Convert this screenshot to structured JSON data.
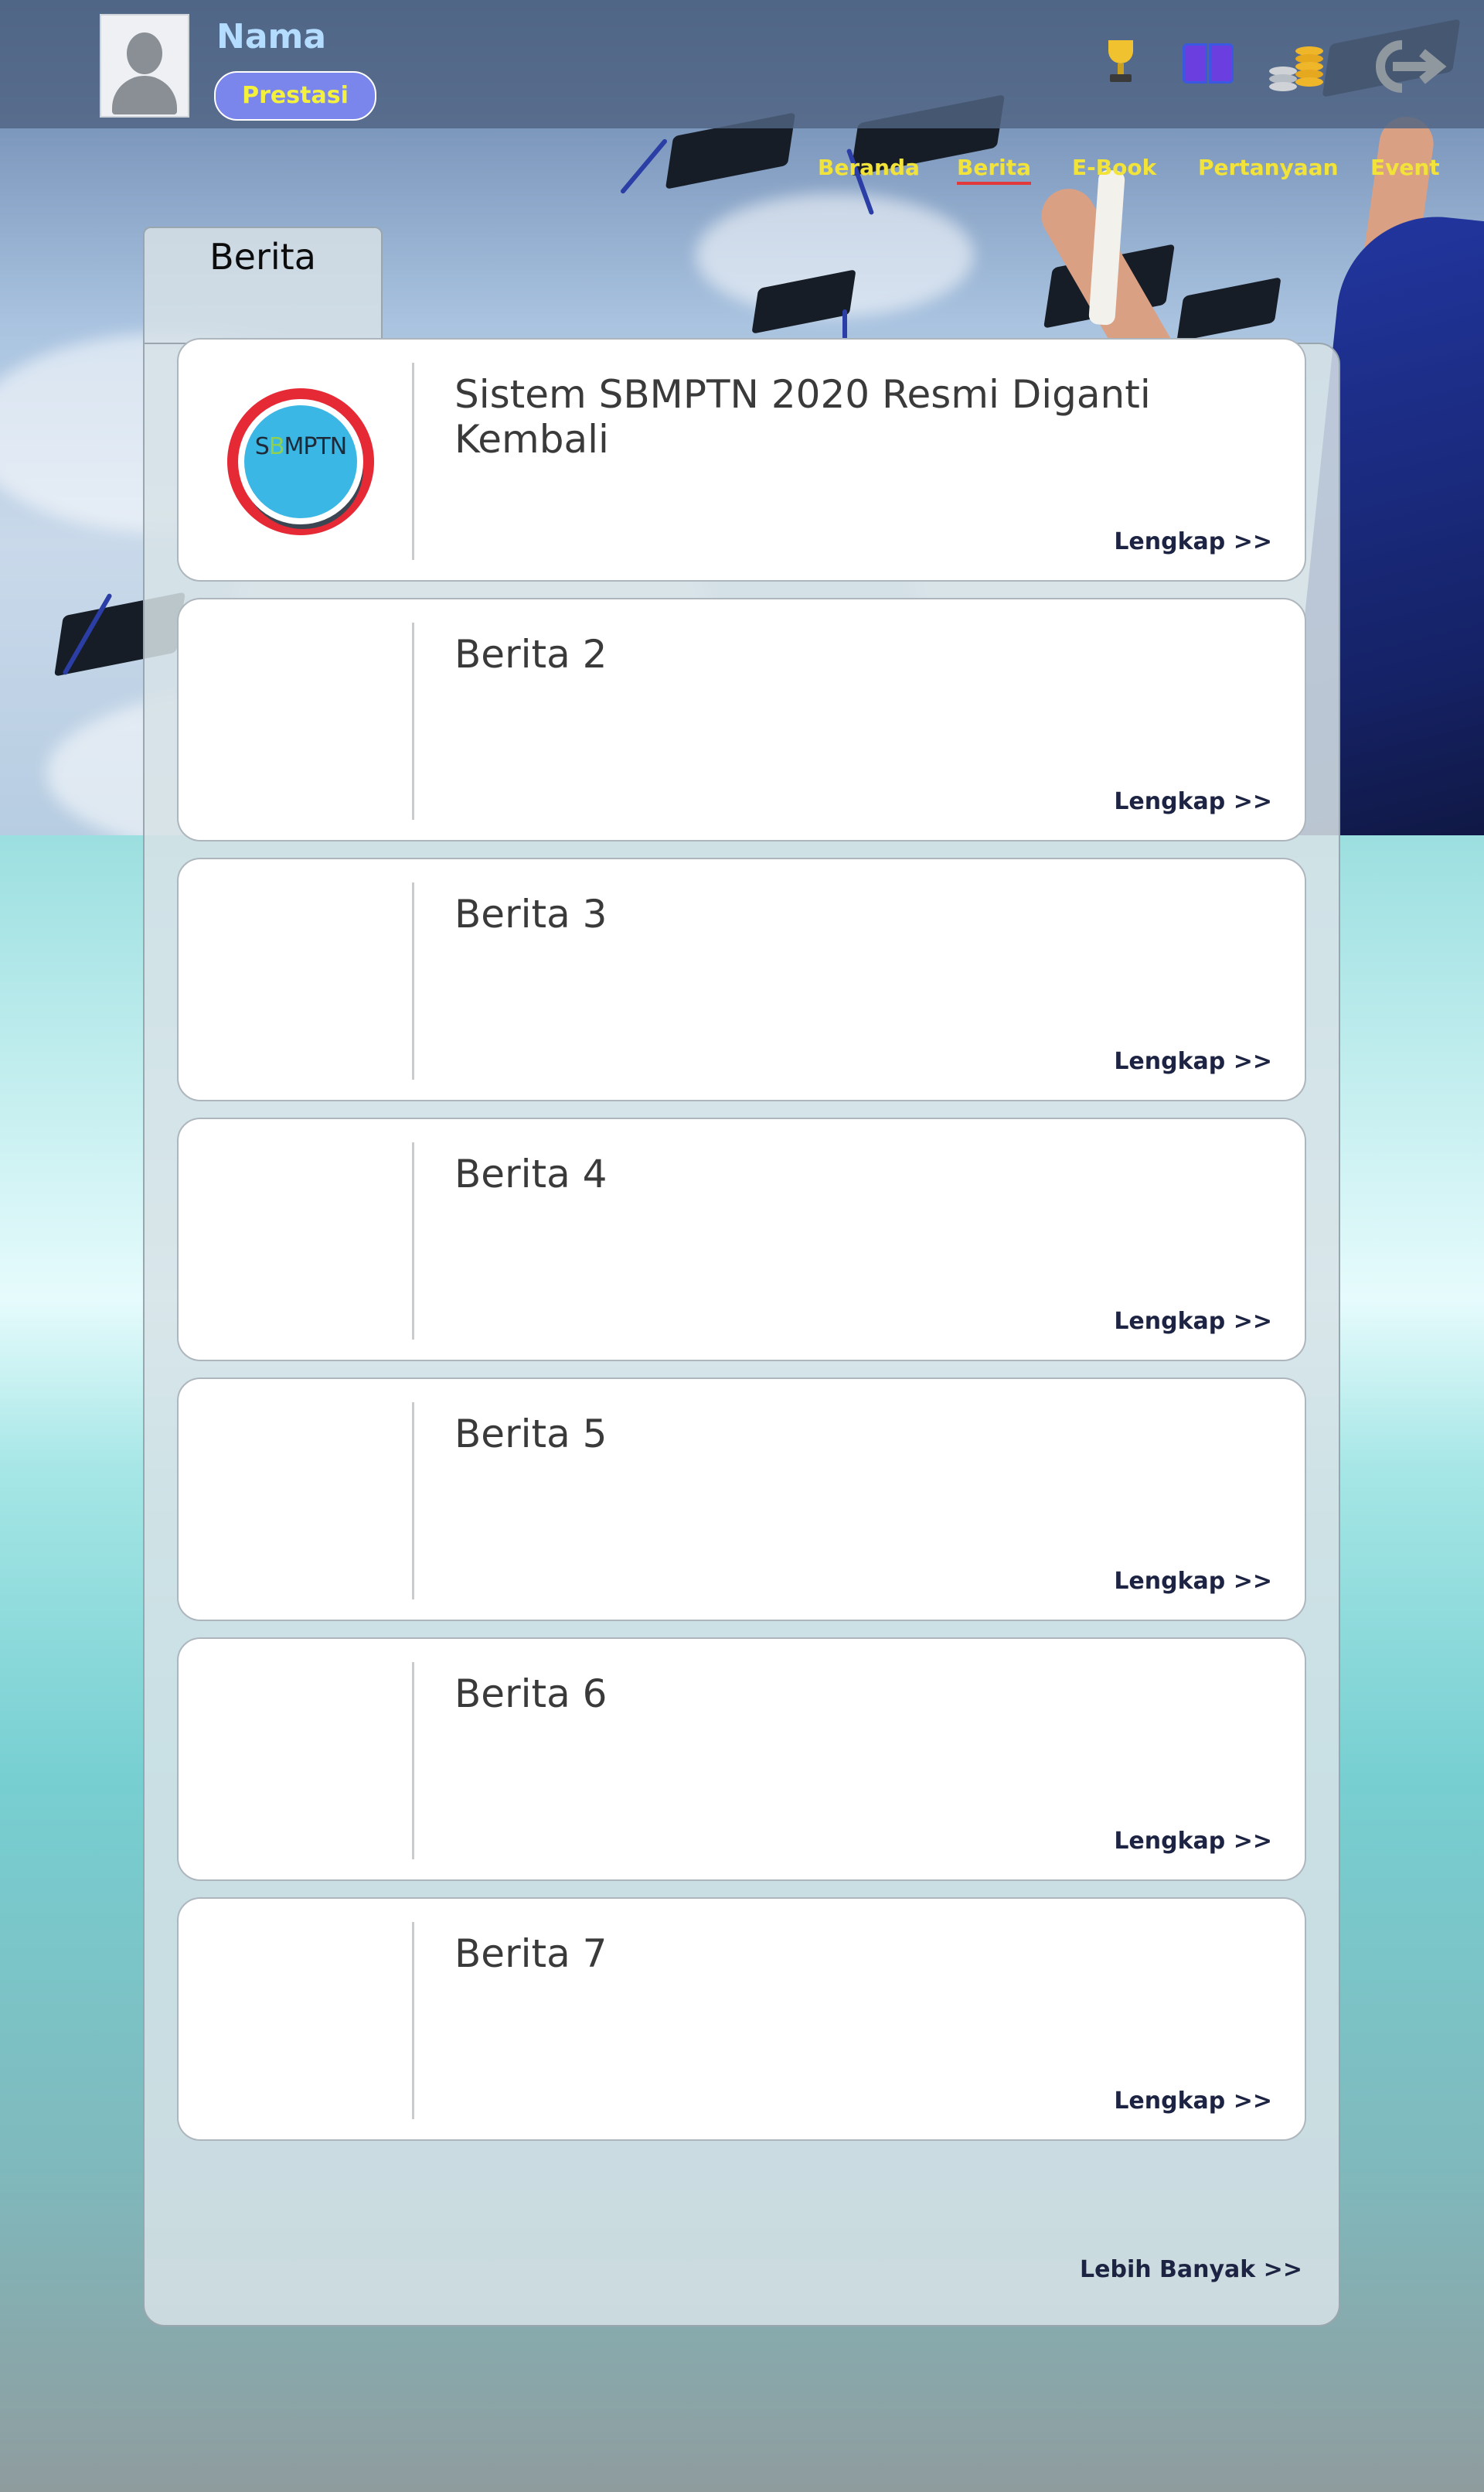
{
  "header": {
    "user_name": "Nama",
    "badge_label": "Prestasi",
    "icons": [
      "trophy-icon",
      "book-icon",
      "coins-icon",
      "logout-icon"
    ]
  },
  "nav": {
    "items": [
      {
        "label": "Beranda"
      },
      {
        "label": "Berita"
      },
      {
        "label": "E-Book"
      },
      {
        "label": "Pertanyaan"
      },
      {
        "label": "Event"
      }
    ],
    "active": "Berita"
  },
  "panel": {
    "tab_label": "Berita",
    "more_all": "Lebih Banyak >>"
  },
  "news": [
    {
      "title": "Sistem SBMPTN 2020 Resmi Diganti Kembali",
      "more": "Lengkap >>",
      "logo_text": "SBMPTN"
    },
    {
      "title": "Berita 2",
      "more": "Lengkap >>"
    },
    {
      "title": "Berita 3",
      "more": "Lengkap >>"
    },
    {
      "title": "Berita 4",
      "more": "Lengkap >>"
    },
    {
      "title": "Berita 5",
      "more": "Lengkap >>"
    },
    {
      "title": "Berita 6",
      "more": "Lengkap >>"
    },
    {
      "title": "Berita 7",
      "more": "Lengkap >>"
    }
  ],
  "colors": {
    "nav_text": "#f2e33a",
    "nav_active_underline": "#e23a3a",
    "badge_bg": "#7b86ec",
    "badge_text": "#f4f03e",
    "link_text": "#1d2443"
  }
}
